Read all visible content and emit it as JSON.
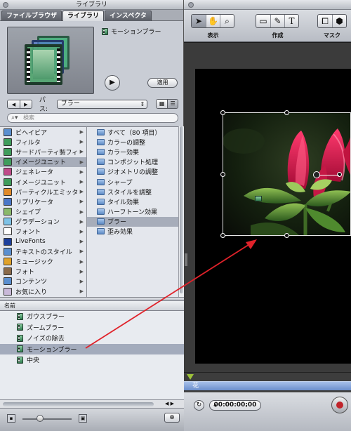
{
  "library": {
    "title": "ライブラリ",
    "tabs": [
      {
        "label": "ファイルブラウザ",
        "active": false
      },
      {
        "label": "ライブラリ",
        "active": true
      },
      {
        "label": "インスペクタ",
        "active": false
      }
    ],
    "preview": {
      "effect_name": "モーションブラー"
    },
    "apply_label": "適用",
    "path_label": "パス:",
    "path_value": "ブラー",
    "search_placeholder": "検索",
    "categories": [
      {
        "label": "ビヘイビア",
        "icon": "behaviors-icon",
        "color": "#5a8fd0"
      },
      {
        "label": "フィルタ",
        "icon": "filters-icon",
        "color": "#3f9c5c"
      },
      {
        "label": "サードパーティ製フィ",
        "icon": "third-party-icon",
        "color": "#3f9c5c"
      },
      {
        "label": "イメージユニット",
        "icon": "image-units-icon",
        "color": "#3f9c5c",
        "selected": true
      },
      {
        "label": "ジェネレータ",
        "icon": "generators-icon",
        "color": "#c04b8a"
      },
      {
        "label": "イメージユニット",
        "icon": "image-units-icon",
        "color": "#3f9c5c"
      },
      {
        "label": "パーティクルエミッタ",
        "icon": "particle-icon",
        "color": "#e08a2a"
      },
      {
        "label": "リプリケータ",
        "icon": "replicator-icon",
        "color": "#4a76c8"
      },
      {
        "label": "シェイプ",
        "icon": "shapes-icon",
        "color": "#8ab86a"
      },
      {
        "label": "グラデーション",
        "icon": "gradient-icon",
        "color": "#7ec2e6"
      },
      {
        "label": "フォント",
        "icon": "fonts-icon",
        "color": "#ffffff"
      },
      {
        "label": "LiveFonts",
        "icon": "livefonts-icon",
        "color": "#1c3f9c"
      },
      {
        "label": "テキストのスタイル",
        "icon": "text-styles-icon",
        "color": "#5a8fd0"
      },
      {
        "label": "ミュージック",
        "icon": "music-icon",
        "color": "#e0a22a"
      },
      {
        "label": "フォト",
        "icon": "photos-icon",
        "color": "#8a6a4a"
      },
      {
        "label": "コンテンツ",
        "icon": "content-icon",
        "color": "#5a8fd0"
      },
      {
        "label": "お気に入り",
        "icon": "favorites-icon",
        "color": "#c9b9d9"
      }
    ],
    "subcategories": [
      {
        "label": "すべて（80 項目）"
      },
      {
        "label": "カラーの調整"
      },
      {
        "label": "カラー効果"
      },
      {
        "label": "コンポジット処理"
      },
      {
        "label": "ジオメトリの調整"
      },
      {
        "label": "シャープ"
      },
      {
        "label": "スタイルを調整"
      },
      {
        "label": "タイル効果"
      },
      {
        "label": "ハーフトーン効果"
      },
      {
        "label": "ブラー",
        "selected": true
      },
      {
        "label": "歪み効果"
      }
    ],
    "list_header": "名前",
    "list_items": [
      {
        "label": "ガウスブラー"
      },
      {
        "label": "ズームブラー"
      },
      {
        "label": "ノイズの除去"
      },
      {
        "label": "モーションブラー",
        "selected": true
      },
      {
        "label": "中央"
      }
    ]
  },
  "canvas": {
    "toolbar_labels": [
      "表示",
      "作成",
      "マスク"
    ],
    "timeline_layer": "花",
    "timecode": "00:00:00;00"
  },
  "colors": {
    "selection": "#a7adba",
    "arrow": "#e0222a",
    "timeline_bar": "#8aa8dc"
  }
}
